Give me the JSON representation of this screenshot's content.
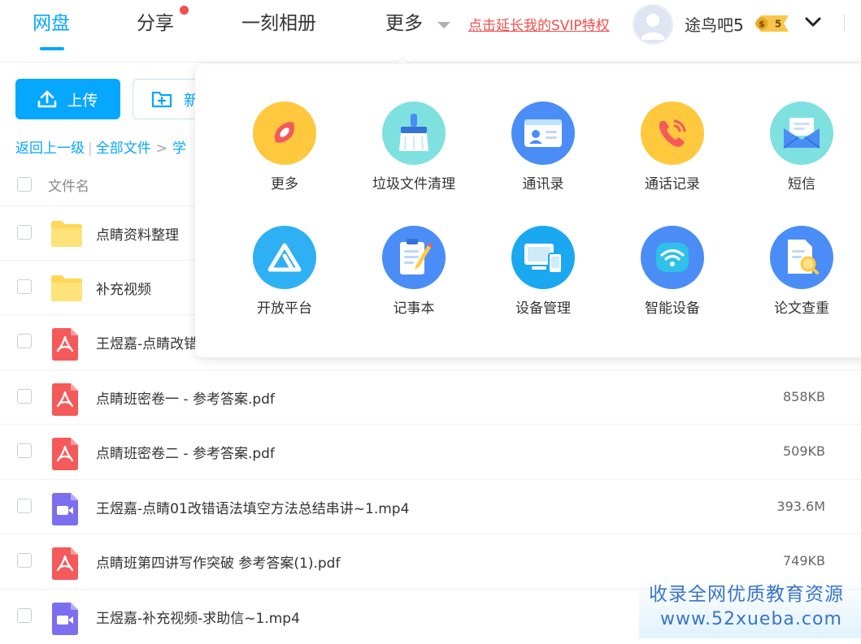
{
  "nav": {
    "tabs": [
      {
        "label": "网盘",
        "active": true
      },
      {
        "label": "分享",
        "has_dot": true
      },
      {
        "label": "一刻相册"
      },
      {
        "label": "更多"
      }
    ],
    "svip_link": "点击延长我的SVIP特权",
    "username": "途鸟吧5",
    "badge_level": "5"
  },
  "toolbar": {
    "upload_label": "上传",
    "new_label": "新"
  },
  "breadcrumb": {
    "back": "返回上一级",
    "all_files": "全部文件",
    "current": "学"
  },
  "list": {
    "header_name": "文件名",
    "rows": [
      {
        "name": "点睛资料整理",
        "type": "folder",
        "size": ""
      },
      {
        "name": "补充视频",
        "type": "folder",
        "size": ""
      },
      {
        "name": "王煜嘉-点睛改错",
        "type": "pdf",
        "size": ""
      },
      {
        "name": "点睛班密卷一 - 参考答案.pdf",
        "type": "pdf",
        "size": "858KB"
      },
      {
        "name": "点睛班密卷二 - 参考答案.pdf",
        "type": "pdf",
        "size": "509KB"
      },
      {
        "name": "王煜嘉-点睛01改错语法填空方法总结串讲~1.mp4",
        "type": "video",
        "size": "393.6M"
      },
      {
        "name": "点睛班第四讲写作突破 参考答案(1).pdf",
        "type": "pdf",
        "size": "749KB"
      },
      {
        "name": "王煜嘉-补充视频-求助信~1.mp4",
        "type": "video",
        "size": ""
      }
    ]
  },
  "more_menu": {
    "tools": [
      {
        "label": "更多",
        "icon": "compass-icon",
        "color": "#ffc83d"
      },
      {
        "label": "垃圾文件清理",
        "icon": "broom-icon",
        "color": "#7fe0e0"
      },
      {
        "label": "通讯录",
        "icon": "contact-card-icon",
        "color": "#4a8df6"
      },
      {
        "label": "通话记录",
        "icon": "phone-icon",
        "color": "#ffc83d"
      },
      {
        "label": "短信",
        "icon": "envelope-icon",
        "color": "#7fe0e0"
      },
      {
        "label": "开放平台",
        "icon": "platform-icon",
        "color": "#2fb0f5"
      },
      {
        "label": "记事本",
        "icon": "notepad-icon",
        "color": "#4a8df6"
      },
      {
        "label": "设备管理",
        "icon": "devices-icon",
        "color": "#1aa8f0"
      },
      {
        "label": "智能设备",
        "icon": "wifi-icon",
        "color": "#4a8df6"
      },
      {
        "label": "论文查重",
        "icon": "document-search-icon",
        "color": "#4a8df6"
      }
    ]
  },
  "watermark": {
    "line1": "收录全网优质教育资源",
    "line2": "www.52xueba.com"
  },
  "colors": {
    "accent": "#06a7ff",
    "danger": "#f34d4d",
    "folder": "#ffd659",
    "pdf": "#f45a5a",
    "video": "#7b6ff0"
  }
}
